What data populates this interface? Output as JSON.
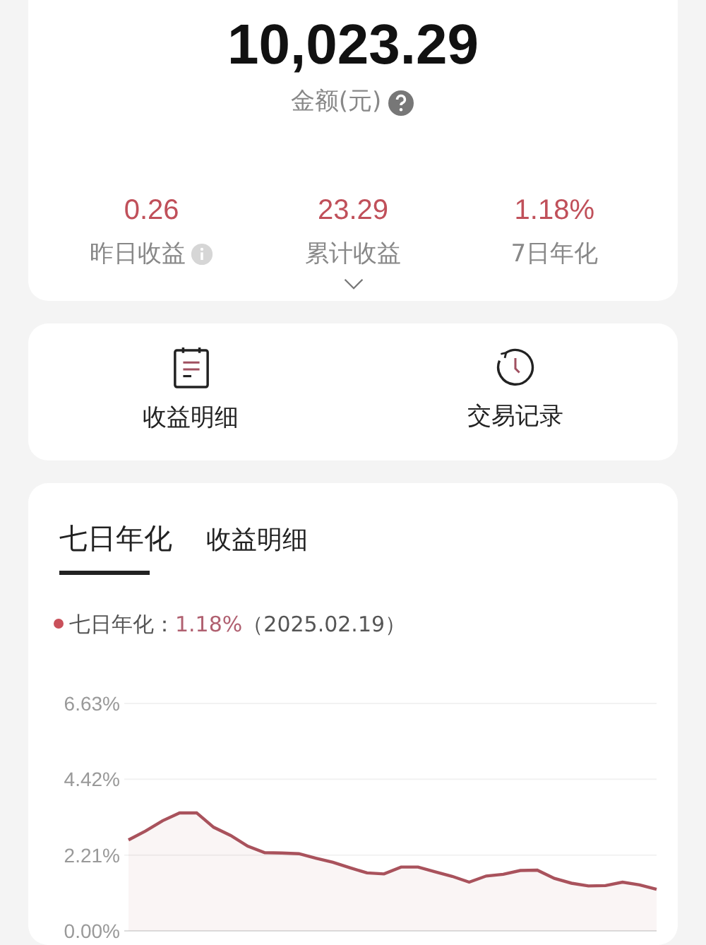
{
  "balance": {
    "amount": "10,023.29",
    "label": "金额(元)"
  },
  "stats": [
    {
      "value": "0.26",
      "label": "昨日收益",
      "info": true
    },
    {
      "value": "23.29",
      "label": "累计收益",
      "info": false
    },
    {
      "value": "1.18%",
      "label": "7日年化",
      "info": false
    }
  ],
  "shortcuts": [
    {
      "kind": "list",
      "label": "收益明细"
    },
    {
      "kind": "clock",
      "label": "交易记录"
    }
  ],
  "tabs": [
    {
      "label": "七日年化",
      "selected": true
    },
    {
      "label": "收益明细",
      "selected": false
    }
  ],
  "legend": {
    "label": "七日年化：",
    "value": "1.18%",
    "date": "（2025.02.19）",
    "color": "#c9505a"
  },
  "chart_data": {
    "type": "area",
    "ylim": [
      0,
      6.63
    ],
    "yticks": [
      {
        "value": 0,
        "label": "0.00%"
      },
      {
        "value": 2.21,
        "label": "2.21%"
      },
      {
        "value": 4.42,
        "label": "4.42%"
      },
      {
        "value": 6.63,
        "label": "6.63%"
      }
    ],
    "series": [
      {
        "color": "#a9525c",
        "values": [
          2.65,
          2.91,
          3.21,
          3.44,
          3.44,
          3.02,
          2.78,
          2.47,
          2.28,
          2.27,
          2.25,
          2.12,
          2.0,
          1.84,
          1.69,
          1.66,
          1.86,
          1.86,
          1.72,
          1.59,
          1.42,
          1.6,
          1.65,
          1.76,
          1.77,
          1.53,
          1.39,
          1.31,
          1.32,
          1.42,
          1.34,
          1.21
        ]
      }
    ]
  }
}
